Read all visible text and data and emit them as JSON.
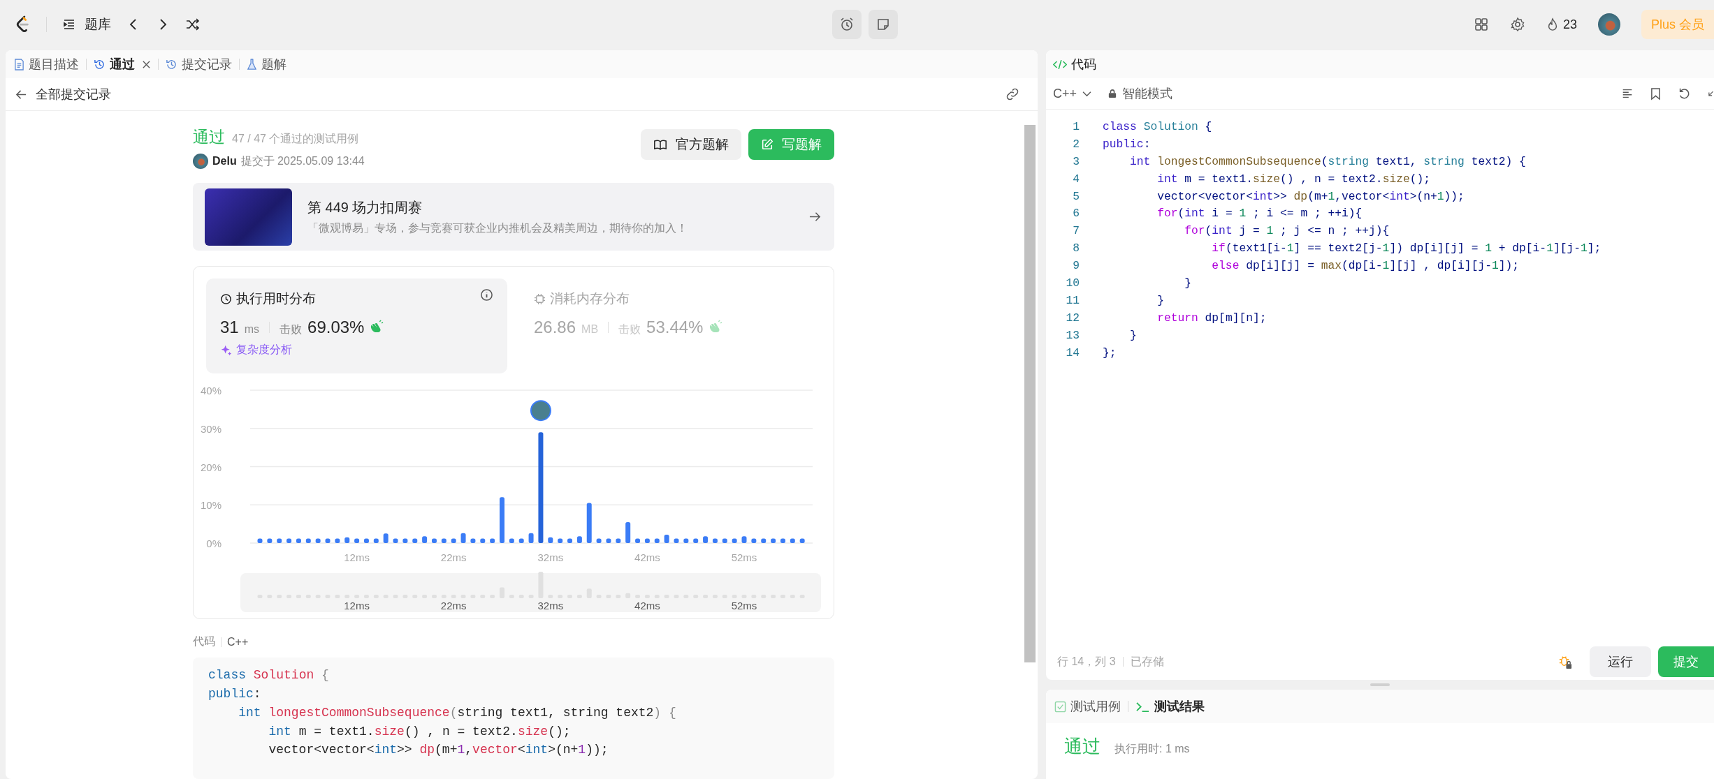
{
  "topbar": {
    "nav_label": "题库",
    "streak": "23",
    "plus_label": "Plus 会员"
  },
  "left_tabs": [
    {
      "label": "题目描述",
      "selected": false
    },
    {
      "label": "通过",
      "selected": true
    },
    {
      "label": "提交记录",
      "selected": false
    },
    {
      "label": "题解",
      "selected": false
    }
  ],
  "back_link": "全部提交记录",
  "submission": {
    "status": "通过",
    "cases": "47 / 47 个通过的测试用例",
    "user": "Delu",
    "submitted": "提交于 2025.05.09 13:44",
    "buttons": [
      {
        "label": "官方题解",
        "kind": "secondary"
      },
      {
        "label": "写题解",
        "kind": "primary"
      }
    ]
  },
  "banner": {
    "title": "第 449 场力扣周赛",
    "description": "「微观博易」专场，参与竞赛可获企业内推机会及精美周边，期待你的加入！"
  },
  "metrics": [
    {
      "title": "执行用时分布",
      "selected": true,
      "value": "31",
      "unit": "ms",
      "beats_label": "击败",
      "beats": "69.03%",
      "link": "复杂度分析"
    },
    {
      "title": "消耗内存分布",
      "selected": false,
      "value": "26.86",
      "unit": "MB",
      "beats_label": "击败",
      "beats": "53.44%"
    }
  ],
  "chart_data": {
    "type": "bar",
    "categories": [
      null,
      null,
      null,
      null,
      null,
      null,
      null,
      null,
      null,
      null,
      "12ms",
      null,
      null,
      null,
      null,
      null,
      null,
      null,
      null,
      null,
      "22ms",
      null,
      null,
      null,
      null,
      null,
      null,
      null,
      null,
      null,
      "32ms",
      null,
      null,
      null,
      null,
      null,
      null,
      null,
      null,
      null,
      "42ms",
      null,
      null,
      null,
      null,
      null,
      null,
      null,
      null,
      null,
      "52ms",
      null,
      null,
      null,
      null,
      null,
      null
    ],
    "values": [
      1.2,
      1.2,
      1.2,
      1.2,
      1.2,
      1.2,
      1.2,
      1.2,
      1.2,
      1.5,
      1.2,
      1.2,
      1.2,
      2.5,
      1.2,
      1.2,
      1.2,
      1.8,
      1.2,
      1.2,
      1.2,
      2.6,
      1.2,
      1.2,
      1.2,
      12,
      1.2,
      1.2,
      2.6,
      29,
      1.5,
      1.2,
      1.2,
      1.8,
      10.5,
      1.2,
      1.2,
      1.2,
      5.5,
      1.2,
      1.2,
      1.2,
      2.2,
      1.2,
      1.2,
      1.2,
      1.8,
      1.2,
      1.2,
      1.2,
      1.8,
      1.2,
      1.2,
      1.2,
      1.2,
      1.2,
      1.2
    ],
    "ylim": [
      0,
      40
    ],
    "yticks": [
      {
        "value": 0,
        "label": "0%"
      },
      {
        "value": 10,
        "label": "10%"
      },
      {
        "value": 20,
        "label": "20%"
      },
      {
        "value": 30,
        "label": "30%"
      },
      {
        "value": 40,
        "label": "40%"
      }
    ],
    "grid": true
  },
  "overview_labels": [
    "12ms",
    "22ms",
    "32ms",
    "42ms",
    "52ms"
  ],
  "code_view": {
    "label": "代码",
    "language": "C++",
    "lines": [
      [
        {
          "kind": "k",
          "text": "class"
        },
        {
          "kind": "cls",
          "text": " Solution"
        },
        {
          "kind": "g",
          "text": " {"
        }
      ],
      [
        {
          "kind": "k",
          "text": "public"
        },
        {
          "kind": "p",
          "text": ":"
        }
      ],
      [
        {
          "kind": "k",
          "text": "    int"
        },
        {
          "kind": "f",
          "text": " longestCommonSubsequence"
        },
        {
          "kind": "g",
          "text": "("
        },
        {
          "kind": "t",
          "text": "string"
        },
        {
          "kind": "p",
          "text": " text1, "
        },
        {
          "kind": "t",
          "text": "string"
        },
        {
          "kind": "p",
          "text": " text2"
        },
        {
          "kind": "g",
          "text": ") {"
        }
      ],
      [
        {
          "kind": "k",
          "text": "        int"
        },
        {
          "kind": "p",
          "text": " m = text1."
        },
        {
          "kind": "f",
          "text": "size"
        },
        {
          "kind": "p",
          "text": "() , n = text2."
        },
        {
          "kind": "f",
          "text": "size"
        },
        {
          "kind": "p",
          "text": "();"
        }
      ],
      [
        {
          "kind": "p",
          "text": "        vector<vector<"
        },
        {
          "kind": "k",
          "text": "int"
        },
        {
          "kind": "p",
          "text": ">> "
        },
        {
          "kind": "f",
          "text": "dp"
        },
        {
          "kind": "p",
          "text": "(m+"
        },
        {
          "kind": "n",
          "text": "1"
        },
        {
          "kind": "p",
          "text": ","
        },
        {
          "kind": "f",
          "text": "vector"
        },
        {
          "kind": "p",
          "text": "<"
        },
        {
          "kind": "k",
          "text": "int"
        },
        {
          "kind": "p",
          "text": ">(n+"
        },
        {
          "kind": "n",
          "text": "1"
        },
        {
          "kind": "p",
          "text": "));"
        }
      ]
    ]
  },
  "editor": {
    "title": "代码",
    "language": "C++",
    "mode": "智能模式",
    "lines": [
      {
        "number": "1",
        "tokens": [
          {
            "kind": "k",
            "text": "class"
          },
          {
            "kind": "cls",
            "text": " Solution"
          },
          {
            "kind": "p",
            "text": " {"
          }
        ]
      },
      {
        "number": "2",
        "tokens": [
          {
            "kind": "k",
            "text": "public"
          },
          {
            "kind": "p",
            "text": ":"
          }
        ]
      },
      {
        "number": "3",
        "tokens": [
          {
            "kind": "k",
            "text": "    int"
          },
          {
            "kind": "f",
            "text": " longestCommonSubsequence"
          },
          {
            "kind": "p",
            "text": "("
          },
          {
            "kind": "t",
            "text": "string"
          },
          {
            "kind": "p",
            "text": " text1, "
          },
          {
            "kind": "t",
            "text": "string"
          },
          {
            "kind": "p",
            "text": " text2) {"
          }
        ]
      },
      {
        "number": "4",
        "tokens": [
          {
            "kind": "k",
            "text": "        int"
          },
          {
            "kind": "p",
            "text": " m = text1."
          },
          {
            "kind": "f",
            "text": "size"
          },
          {
            "kind": "p",
            "text": "() , n = text2."
          },
          {
            "kind": "f",
            "text": "size"
          },
          {
            "kind": "p",
            "text": "();"
          }
        ]
      },
      {
        "number": "5",
        "tokens": [
          {
            "kind": "p",
            "text": "        vector<vector<"
          },
          {
            "kind": "k",
            "text": "int"
          },
          {
            "kind": "p",
            "text": ">> "
          },
          {
            "kind": "f",
            "text": "dp"
          },
          {
            "kind": "p",
            "text": "(m+"
          },
          {
            "kind": "n",
            "text": "1"
          },
          {
            "kind": "p",
            "text": ",vector<"
          },
          {
            "kind": "k",
            "text": "int"
          },
          {
            "kind": "p",
            "text": ">(n+"
          },
          {
            "kind": "n",
            "text": "1"
          },
          {
            "kind": "p",
            "text": "));"
          }
        ]
      },
      {
        "number": "6",
        "tokens": [
          {
            "kind": "c",
            "text": "        for"
          },
          {
            "kind": "p",
            "text": "("
          },
          {
            "kind": "k",
            "text": "int"
          },
          {
            "kind": "p",
            "text": " i = "
          },
          {
            "kind": "n",
            "text": "1"
          },
          {
            "kind": "p",
            "text": " ; i <= m ; ++i){"
          }
        ]
      },
      {
        "number": "7",
        "tokens": [
          {
            "kind": "c",
            "text": "            for"
          },
          {
            "kind": "p",
            "text": "("
          },
          {
            "kind": "k",
            "text": "int"
          },
          {
            "kind": "p",
            "text": " j = "
          },
          {
            "kind": "n",
            "text": "1"
          },
          {
            "kind": "p",
            "text": " ; j <= n ; ++j){"
          }
        ]
      },
      {
        "number": "8",
        "tokens": [
          {
            "kind": "c",
            "text": "                if"
          },
          {
            "kind": "p",
            "text": "(text1[i-"
          },
          {
            "kind": "n",
            "text": "1"
          },
          {
            "kind": "p",
            "text": "] == text2[j-"
          },
          {
            "kind": "n",
            "text": "1"
          },
          {
            "kind": "p",
            "text": "]) dp[i][j] = "
          },
          {
            "kind": "n",
            "text": "1"
          },
          {
            "kind": "p",
            "text": " + dp[i-"
          },
          {
            "kind": "n",
            "text": "1"
          },
          {
            "kind": "p",
            "text": "][j-"
          },
          {
            "kind": "n",
            "text": "1"
          },
          {
            "kind": "p",
            "text": "];"
          }
        ]
      },
      {
        "number": "9",
        "tokens": [
          {
            "kind": "c",
            "text": "                else"
          },
          {
            "kind": "p",
            "text": " dp[i][j] = "
          },
          {
            "kind": "f",
            "text": "max"
          },
          {
            "kind": "p",
            "text": "(dp[i-"
          },
          {
            "kind": "n",
            "text": "1"
          },
          {
            "kind": "p",
            "text": "][j] , dp[i][j-"
          },
          {
            "kind": "n",
            "text": "1"
          },
          {
            "kind": "p",
            "text": "]);"
          }
        ]
      },
      {
        "number": "10",
        "tokens": [
          {
            "kind": "p",
            "text": "            }"
          }
        ]
      },
      {
        "number": "11",
        "tokens": [
          {
            "kind": "p",
            "text": "        }"
          }
        ]
      },
      {
        "number": "12",
        "tokens": [
          {
            "kind": "c",
            "text": "        return"
          },
          {
            "kind": "p",
            "text": " dp[m][n];"
          }
        ]
      },
      {
        "number": "13",
        "tokens": [
          {
            "kind": "p",
            "text": "    }"
          }
        ]
      },
      {
        "number": "14",
        "tokens": [
          {
            "kind": "p",
            "text": "};"
          }
        ]
      }
    ],
    "cursor": "行 14，列 3",
    "saved": "已存储",
    "run": "运行",
    "submit": "提交"
  },
  "bottom_tabs": [
    {
      "label": "测试用例",
      "selected": false
    },
    {
      "label": "测试结果",
      "selected": true
    }
  ],
  "result": {
    "status": "通过",
    "runtime": "执行用时: 1 ms"
  }
}
